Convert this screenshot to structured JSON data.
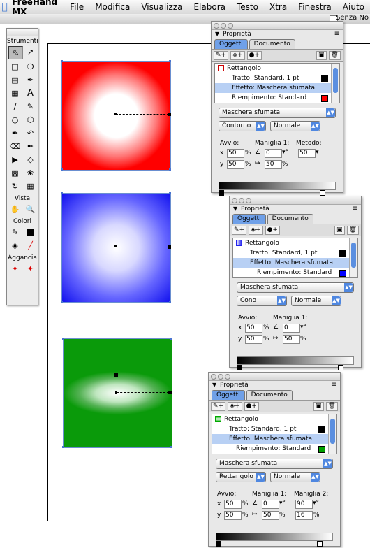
{
  "menubar": {
    "app": "FreeHand MX",
    "items": [
      "File",
      "Modifica",
      "Visualizza",
      "Elabora",
      "Testo",
      "Xtra",
      "Finestra",
      "Aiuto"
    ]
  },
  "document": {
    "title": "Senza No"
  },
  "toolbox": {
    "title": "Strumenti",
    "section_view": "Vista",
    "section_colors": "Colori",
    "section_snap": "Aggancia"
  },
  "panels": [
    {
      "title": "Proprietà",
      "tabs": [
        "Oggetti",
        "Documento"
      ],
      "object": "Rettangolo",
      "object_color": "#e00000",
      "rows": [
        "Tratto: Standard, 1 pt",
        "Effetto: Maschera sfumata",
        "Riempimento: Standard"
      ],
      "fill_color": "#ff0000",
      "effect": "Maschera sfumata",
      "type": "Contorno",
      "mode": "Normale",
      "label_start": "Avvio:",
      "label_handle1": "Maniglia 1:",
      "label_method": "Metodo:",
      "x": "50",
      "y": "50",
      "angle": "0",
      "len": "50",
      "method": "50",
      "pct": "%"
    },
    {
      "title": "Proprietà",
      "tabs": [
        "Oggetti",
        "Documento"
      ],
      "object": "Rettangolo",
      "object_color": "#2222ee",
      "rows": [
        "Tratto: Standard, 1 pt",
        "Effetto: Maschera sfumata",
        "Riempimento: Standard"
      ],
      "fill_color": "#0000ff",
      "effect": "Maschera sfumata",
      "type": "Cono",
      "mode": "Normale",
      "label_start": "Avvio:",
      "label_handle1": "Maniglia 1:",
      "x": "50",
      "y": "50",
      "angle": "0",
      "len": "50",
      "pct": "%"
    },
    {
      "title": "Proprietà",
      "tabs": [
        "Oggetti",
        "Documento"
      ],
      "object": "Rettangolo",
      "object_color": "#00aa00",
      "rows": [
        "Tratto: Standard, 1 pt",
        "Effetto: Maschera sfumata",
        "Riempimento: Standard"
      ],
      "fill_color": "#00a000",
      "effect": "Maschera sfumata",
      "type": "Rettangolo",
      "mode": "Normale",
      "label_start": "Avvio:",
      "label_handle1": "Maniglia 1:",
      "label_handle2": "Maniglia 2:",
      "x": "50",
      "y": "50",
      "angle": "0",
      "len": "50",
      "angle2": "90",
      "len2": "16",
      "pct": "%"
    }
  ]
}
